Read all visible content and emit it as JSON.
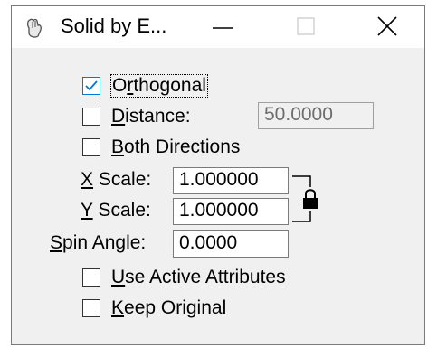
{
  "window": {
    "title": "Solid by E..."
  },
  "options": {
    "orthogonal": {
      "label_pre": "O",
      "label_u": "r",
      "label_post": "thogonal",
      "checked": true
    },
    "distance": {
      "label_pre": "",
      "label_u": "D",
      "label_post": "istance:",
      "checked": false,
      "value": "50.0000",
      "enabled": false
    },
    "both_directions": {
      "label_pre": "",
      "label_u": "B",
      "label_post": "oth Directions",
      "checked": false
    },
    "use_active_attributes": {
      "label_pre": "",
      "label_u": "U",
      "label_post": "se Active Attributes",
      "checked": false
    },
    "keep_original": {
      "label_pre": "",
      "label_u": "K",
      "label_post": "eep Original",
      "checked": false
    }
  },
  "fields": {
    "x_scale": {
      "label_u": "X",
      "label_post": " Scale:",
      "value": "1.000000"
    },
    "y_scale": {
      "label_u": "Y",
      "label_post": " Scale:",
      "value": "1.000000"
    },
    "spin_angle": {
      "label_u": "S",
      "label_post": "pin Angle:",
      "value": "0.0000"
    }
  },
  "scale_lock": {
    "locked": true,
    "icon": "padlock-icon"
  }
}
